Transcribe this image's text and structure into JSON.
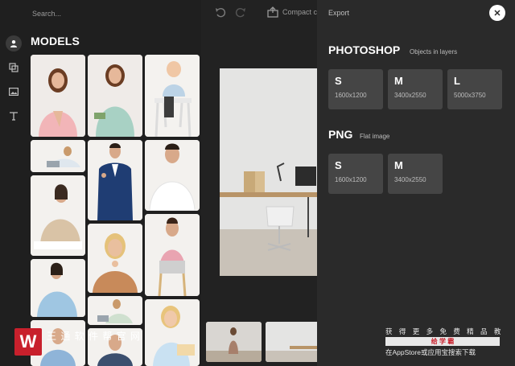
{
  "search": {
    "placeholder": "Search..."
  },
  "rail": {
    "icons": [
      "user-icon",
      "layers-icon",
      "image-icon",
      "text-icon"
    ]
  },
  "models": {
    "title": "MODELS",
    "thumbs": [
      "model-pink-blouse",
      "model-mint-shirt",
      "model-baby-highchair",
      "model-laptop-lying",
      "model-suit-phone",
      "model-white-sweater",
      "model-beige-blazer",
      "model-thinking-woman",
      "model-surprised-chair",
      "model-blue-blazer",
      "model-laptop-floor",
      "model-girl-tablet"
    ]
  },
  "toolbar": {
    "compact_label": "Compact c"
  },
  "export": {
    "header": "Export",
    "formats": [
      {
        "name": "PHOTOSHOP",
        "subtitle": "Objects in layers",
        "sizes": [
          {
            "label": "S",
            "dims": "1600x1200"
          },
          {
            "label": "M",
            "dims": "3400x2550"
          },
          {
            "label": "L",
            "dims": "5000x3750"
          }
        ]
      },
      {
        "name": "PNG",
        "subtitle": "Flat image",
        "sizes": [
          {
            "label": "S",
            "dims": "1600x1200"
          },
          {
            "label": "M",
            "dims": "3400x2550"
          }
        ]
      }
    ]
  },
  "watermark": {
    "logo": "W",
    "name": "王 通 软 件 帮 官 网",
    "line1": "获 得 更 多 免 费 精 品 教 程",
    "line2": "给 学 霸",
    "line3": "在AppStore或应用宝搜索下载"
  },
  "colors": {
    "panel_bg": "#1f1f1f",
    "export_bg": "#2a2a2a",
    "card_bg": "#454545",
    "accent": "#ffffff"
  }
}
